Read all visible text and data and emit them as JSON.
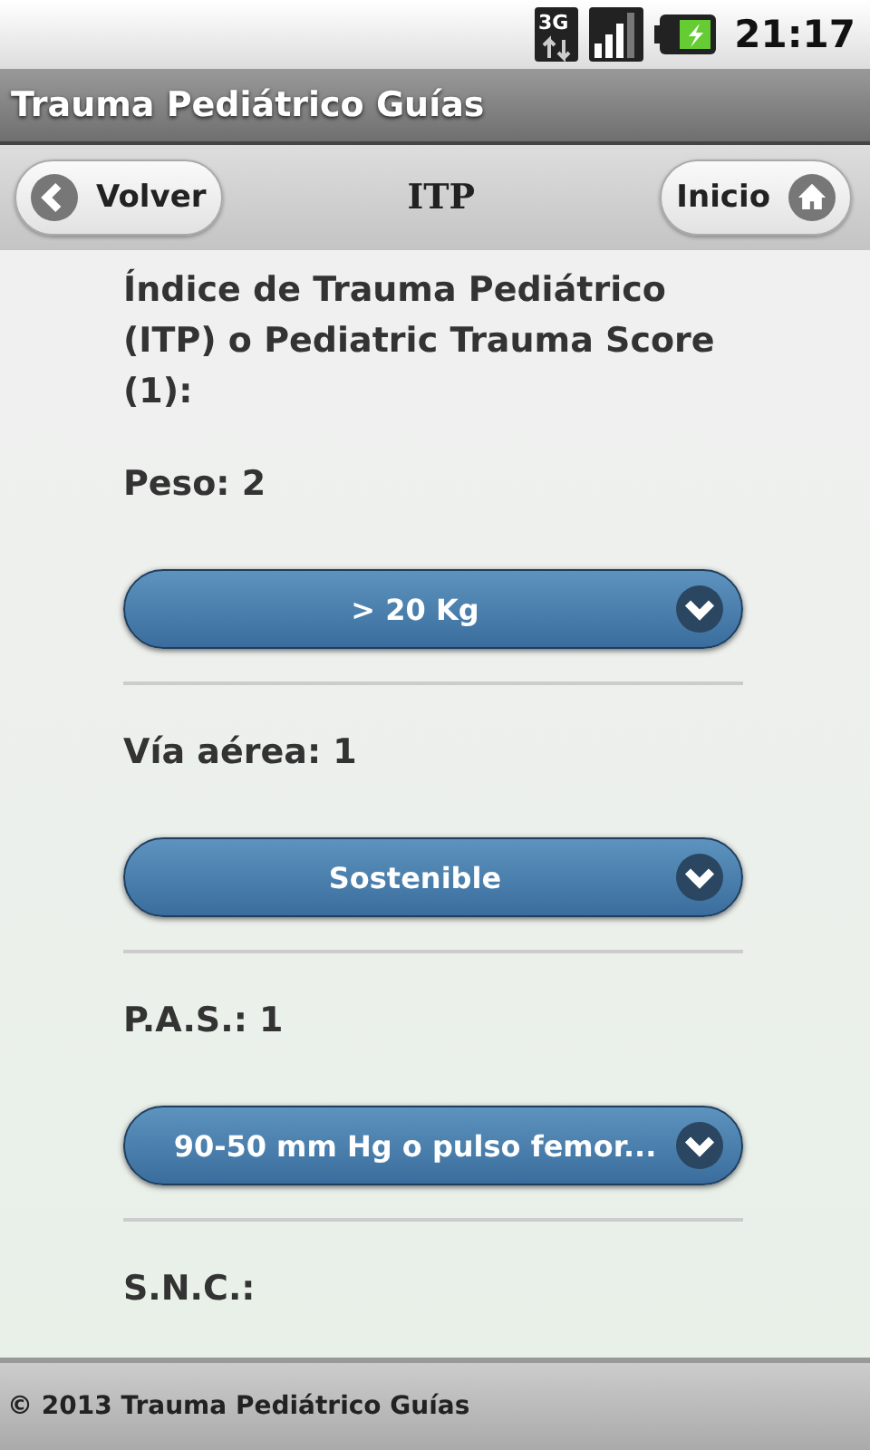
{
  "status_bar": {
    "network": "3G",
    "time": "21:17"
  },
  "app_title": "Trauma Pediátrico Guías",
  "header": {
    "back_button": "Volver",
    "title": "ITP",
    "home_button": "Inicio"
  },
  "heading": "Índice de Trauma Pediátrico (ITP) o Pediatric Trauma Score (1):",
  "fields": [
    {
      "label": "Peso: 2",
      "value": "> 20 Kg"
    },
    {
      "label": "Vía aérea: 1",
      "value": "Sostenible"
    },
    {
      "label": "P.A.S.: 1",
      "value": "90-50 mm Hg o pulso femor..."
    }
  ],
  "next_label": "S.N.C.:",
  "footer": "© 2013 Trauma Pediátrico Guías"
}
